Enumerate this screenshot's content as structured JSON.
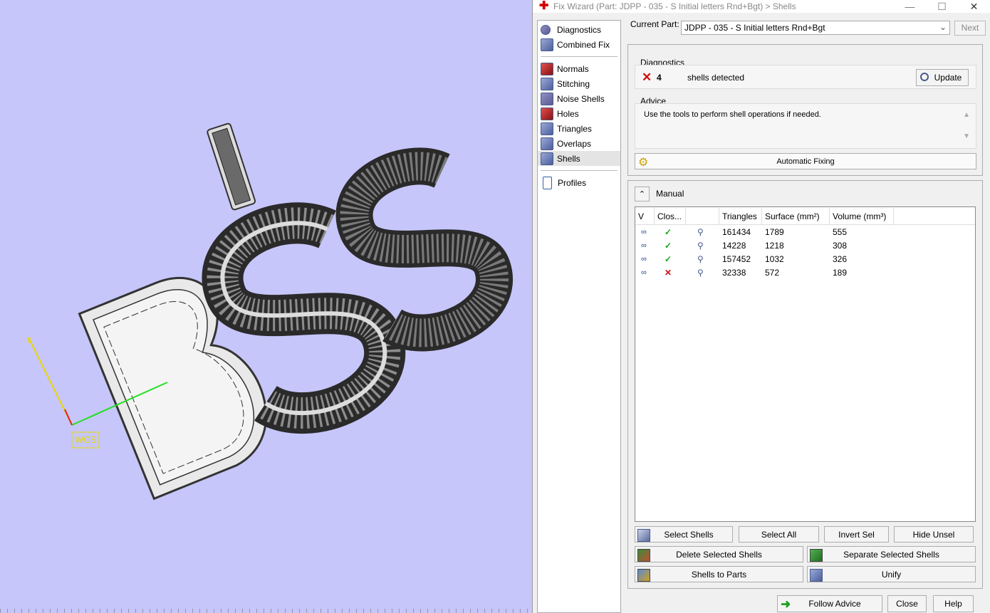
{
  "window": {
    "title": "Fix Wizard (Part: JDPP - 035 - S Initial letters Rnd+Bgt) > Shells",
    "minimize": "—",
    "maximize": "☐",
    "close": "✕"
  },
  "viewport": {
    "wcs_label": "WCS",
    "background": "#c6c6fa"
  },
  "nav": {
    "items": [
      {
        "label": "Diagnostics",
        "icon": "magnifier-icon"
      },
      {
        "label": "Combined Fix",
        "icon": "cube-icon"
      },
      {
        "label": "Normals",
        "icon": "normals-icon"
      },
      {
        "label": "Stitching",
        "icon": "stitching-icon"
      },
      {
        "label": "Noise Shells",
        "icon": "noise-shells-icon"
      },
      {
        "label": "Holes",
        "icon": "holes-icon"
      },
      {
        "label": "Triangles",
        "icon": "triangles-icon"
      },
      {
        "label": "Overlaps",
        "icon": "overlaps-icon"
      },
      {
        "label": "Shells",
        "icon": "shells-icon"
      },
      {
        "label": "Profiles",
        "icon": "document-icon"
      }
    ],
    "selected": "Shells"
  },
  "current_part": {
    "label": "Current Part:",
    "value": "JDPP - 035 - S Initial letters Rnd+Bgt",
    "next_label": "Next"
  },
  "diagnostics": {
    "group_label": "Diagnostics",
    "count": "4",
    "status_text": "shells detected",
    "update_label": "Update"
  },
  "advice": {
    "group_label": "Advice",
    "text": "Use the tools to perform shell operations if needed."
  },
  "automatic_fixing_label": "Automatic Fixing",
  "manual": {
    "label": "Manual",
    "columns": [
      "V",
      "Clos...",
      "",
      "Triangles",
      "Surface (mm²)",
      "Volume (mm³)"
    ],
    "rows": [
      {
        "closed": "true",
        "triangles": "161434",
        "surface": "1789",
        "volume": "555"
      },
      {
        "closed": "true",
        "triangles": "14228",
        "surface": "1218",
        "volume": "308"
      },
      {
        "closed": "true",
        "triangles": "157452",
        "surface": "1032",
        "volume": "326"
      },
      {
        "closed": "false",
        "triangles": "32338",
        "surface": "572",
        "volume": "189"
      }
    ],
    "buttons": {
      "select_shells": "Select Shells",
      "select_all": "Select All",
      "invert_sel": "Invert Sel",
      "hide_unsel": "Hide Unsel",
      "delete_selected": "Delete Selected Shells",
      "separate_selected": "Separate Selected Shells",
      "shells_to_parts": "Shells to Parts",
      "unify": "Unify"
    }
  },
  "footer": {
    "follow_advice": "Follow Advice",
    "close": "Close",
    "help": "Help"
  },
  "colors": {
    "check": "#1aa31a",
    "cross": "#d01010",
    "axis_x": "#e02020",
    "axis_y": "#20d020",
    "axis_z": "#e8d800"
  }
}
